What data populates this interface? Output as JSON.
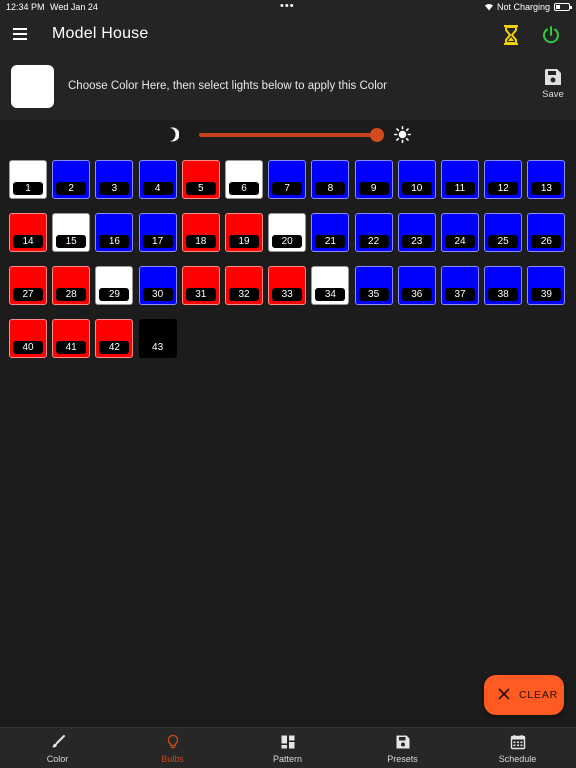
{
  "statusbar": {
    "time": "12:34 PM",
    "date": "Wed Jan 24",
    "charging": "Not Charging"
  },
  "appbar": {
    "title": "Model House",
    "timer_icon_color": "#f0d000",
    "power_icon_color": "#2ecc40"
  },
  "color_picker": {
    "selected_color": "#ffffff",
    "hint": "Choose Color Here, then select lights below to apply this Color",
    "save_label": "Save"
  },
  "brightness": {
    "value_fraction": 0.96,
    "accent": "#c7421a"
  },
  "bulbs": [
    {
      "num": "1",
      "color": "white"
    },
    {
      "num": "2",
      "color": "blue"
    },
    {
      "num": "3",
      "color": "blue"
    },
    {
      "num": "4",
      "color": "blue"
    },
    {
      "num": "5",
      "color": "red"
    },
    {
      "num": "6",
      "color": "white"
    },
    {
      "num": "7",
      "color": "blue"
    },
    {
      "num": "8",
      "color": "blue"
    },
    {
      "num": "9",
      "color": "blue"
    },
    {
      "num": "10",
      "color": "blue"
    },
    {
      "num": "11",
      "color": "blue"
    },
    {
      "num": "12",
      "color": "blue"
    },
    {
      "num": "13",
      "color": "blue"
    },
    {
      "num": "14",
      "color": "red"
    },
    {
      "num": "15",
      "color": "white"
    },
    {
      "num": "16",
      "color": "blue"
    },
    {
      "num": "17",
      "color": "blue"
    },
    {
      "num": "18",
      "color": "red"
    },
    {
      "num": "19",
      "color": "red"
    },
    {
      "num": "20",
      "color": "white"
    },
    {
      "num": "21",
      "color": "blue"
    },
    {
      "num": "22",
      "color": "blue"
    },
    {
      "num": "23",
      "color": "blue"
    },
    {
      "num": "24",
      "color": "blue"
    },
    {
      "num": "25",
      "color": "blue"
    },
    {
      "num": "26",
      "color": "blue"
    },
    {
      "num": "27",
      "color": "red"
    },
    {
      "num": "28",
      "color": "red"
    },
    {
      "num": "29",
      "color": "white"
    },
    {
      "num": "30",
      "color": "blue"
    },
    {
      "num": "31",
      "color": "red"
    },
    {
      "num": "32",
      "color": "red"
    },
    {
      "num": "33",
      "color": "red"
    },
    {
      "num": "34",
      "color": "white"
    },
    {
      "num": "35",
      "color": "blue"
    },
    {
      "num": "36",
      "color": "blue"
    },
    {
      "num": "37",
      "color": "blue"
    },
    {
      "num": "38",
      "color": "blue"
    },
    {
      "num": "39",
      "color": "blue"
    },
    {
      "num": "40",
      "color": "red"
    },
    {
      "num": "41",
      "color": "red"
    },
    {
      "num": "42",
      "color": "red"
    },
    {
      "num": "43",
      "color": "black"
    }
  ],
  "clear_label": "CLEAR",
  "nav": {
    "items": [
      {
        "label": "Color",
        "icon": "brush-icon"
      },
      {
        "label": "Bulbs",
        "icon": "bulb-icon",
        "active": true
      },
      {
        "label": "Pattern",
        "icon": "grid-layout-icon"
      },
      {
        "label": "Presets",
        "icon": "save-icon"
      },
      {
        "label": "Schedule",
        "icon": "calendar-icon"
      }
    ]
  }
}
